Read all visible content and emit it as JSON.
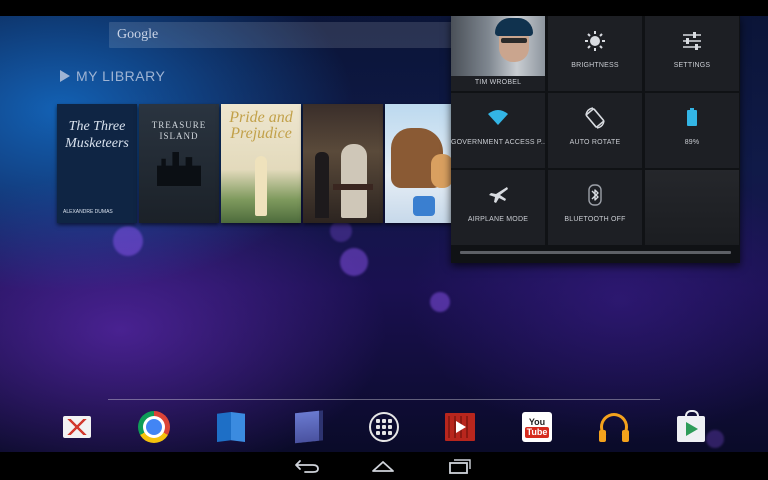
{
  "search": {
    "label": "Google"
  },
  "library": {
    "title": "MY LIBRARY"
  },
  "books": [
    {
      "title": "The Three Musketeers",
      "author": "ALEXANDRE DUMAS"
    },
    {
      "title": "TREASURE ISLAND"
    },
    {
      "title": "Pride and Prejudice"
    },
    {
      "title": ""
    },
    {
      "title": ""
    }
  ],
  "dock": {
    "apps": [
      "gmail-icon",
      "chrome-icon",
      "play-books-icon",
      "play-magazines-icon",
      "all-apps-icon",
      "play-movies-icon",
      "youtube-icon",
      "play-music-icon",
      "play-store-icon"
    ],
    "youtube_you": "You",
    "youtube_tube": "Tube"
  },
  "quick_settings": {
    "user": {
      "label": "TIM WROBEL"
    },
    "brightness": {
      "label": "BRIGHTNESS"
    },
    "settings": {
      "label": "SETTINGS"
    },
    "wifi": {
      "label": "GOVERNMENT ACCESS P..."
    },
    "auto_rotate": {
      "label": "AUTO ROTATE"
    },
    "battery": {
      "label": "89%"
    },
    "airplane": {
      "label": "AIRPLANE MODE"
    },
    "bluetooth": {
      "label": "BLUETOOTH OFF"
    }
  },
  "colors": {
    "accent": "#33b5e5",
    "panel": "#101215",
    "tile": "#1d1f24"
  }
}
